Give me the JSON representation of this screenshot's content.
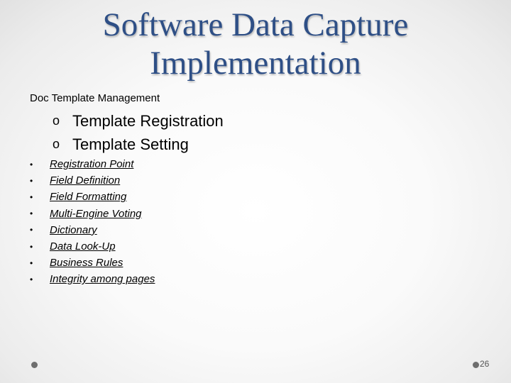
{
  "slide": {
    "title_lines": [
      "Software Data Capture",
      "Implementation"
    ],
    "section_heading": "Doc Template Management",
    "sub_bullet_icon": "hollow-circle-icon",
    "sub_items": [
      "Template Registration",
      "Template Setting"
    ],
    "link_bullet_icon": "dot-bullet-icon",
    "link_items": [
      "Registration Point",
      "Field Definition",
      "Field Formatting",
      "Multi-Engine Voting",
      "Dictionary",
      "Data Look-Up",
      "Business Rules",
      "Integrity among pages"
    ],
    "page_number": "26",
    "colors": {
      "title": "#2e4f86",
      "footer_dot": "#6e6e6e"
    }
  }
}
